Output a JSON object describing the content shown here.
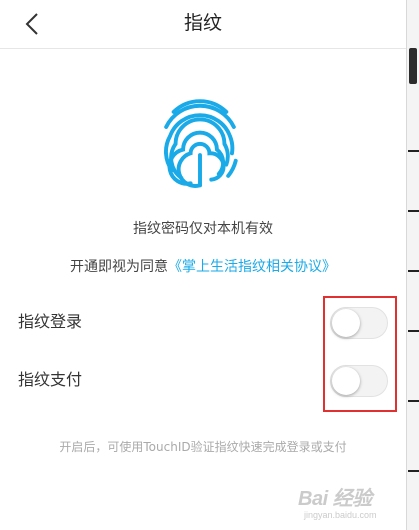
{
  "header": {
    "title": "指纹",
    "back_icon": "chevron-left-icon"
  },
  "hero": {
    "icon": "fingerprint-icon",
    "icon_color": "#1aaae8",
    "note": "指纹密码仅对本机有效",
    "agree_prefix": "开通即视为同意",
    "agree_link": "《掌上生活指纹相关协议》"
  },
  "settings": {
    "rows": [
      {
        "label": "指纹登录",
        "enabled": false
      },
      {
        "label": "指纹支付",
        "enabled": false
      }
    ]
  },
  "footer_note": "开启后，可使用TouchID验证指纹快速完成登录或支付",
  "watermark": {
    "brand": "Bai 经验",
    "sub": "jingyan.baidu.com"
  },
  "colors": {
    "accent": "#1aaae8",
    "highlight_box": "#e03030"
  }
}
